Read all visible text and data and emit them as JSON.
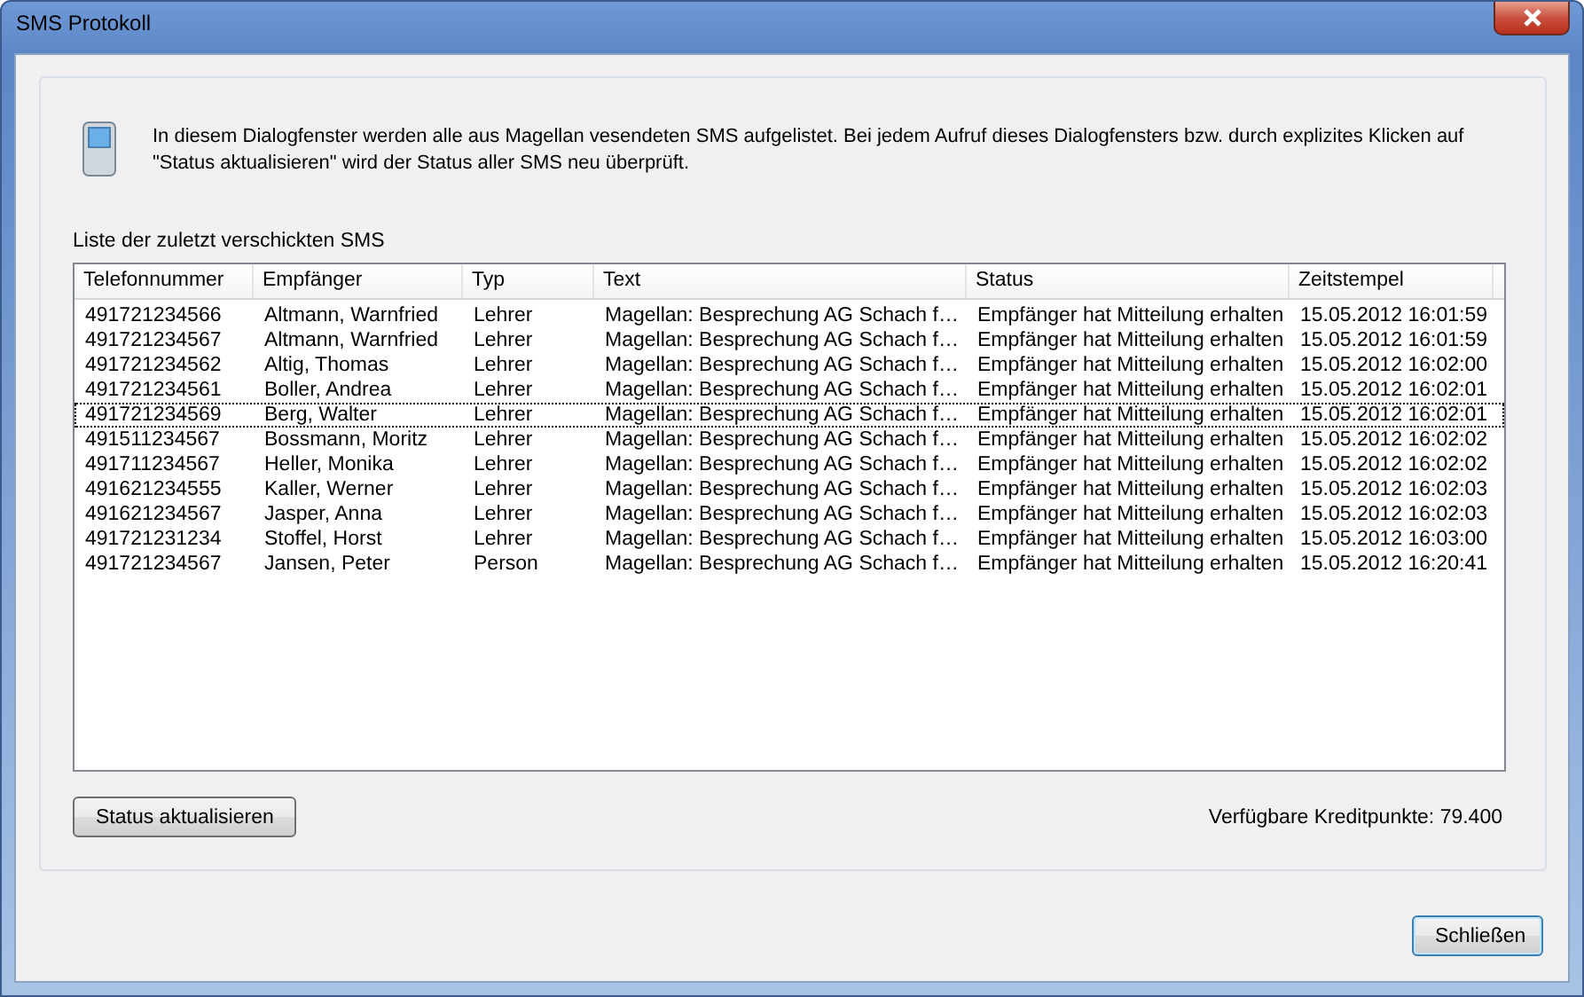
{
  "window": {
    "title": "SMS Protokoll"
  },
  "info_text": "In diesem Dialogfenster werden alle aus Magellan vesendeten SMS aufgelistet. Bei jedem Aufruf dieses Dialogfensters bzw. durch explizites Klicken auf \"Status aktualisieren\" wird der Status aller SMS neu überprüft.",
  "list_label": "Liste der zuletzt verschickten SMS",
  "table": {
    "columns": [
      "Telefonnummer",
      "Empfänger",
      "Typ",
      "Text",
      "Status",
      "Zeitstempel"
    ],
    "rows": [
      {
        "cells": [
          "491721234566",
          "Altmann, Warnfried",
          "Lehrer",
          "Magellan: Besprechung AG Schach f…",
          "Empfänger hat Mitteilung erhalten",
          "15.05.2012 16:01:59"
        ],
        "focused": false
      },
      {
        "cells": [
          "491721234567",
          "Altmann, Warnfried",
          "Lehrer",
          "Magellan: Besprechung AG Schach f…",
          "Empfänger hat Mitteilung erhalten",
          "15.05.2012 16:01:59"
        ],
        "focused": false
      },
      {
        "cells": [
          "491721234562",
          "Altig, Thomas",
          "Lehrer",
          "Magellan: Besprechung AG Schach f…",
          "Empfänger hat Mitteilung erhalten",
          "15.05.2012 16:02:00"
        ],
        "focused": false
      },
      {
        "cells": [
          "491721234561",
          "Boller, Andrea",
          "Lehrer",
          "Magellan: Besprechung AG Schach f…",
          "Empfänger hat Mitteilung erhalten",
          "15.05.2012 16:02:01"
        ],
        "focused": false
      },
      {
        "cells": [
          "491721234569",
          "Berg, Walter",
          "Lehrer",
          "Magellan: Besprechung AG Schach f…",
          "Empfänger hat Mitteilung erhalten",
          "15.05.2012 16:02:01"
        ],
        "focused": true
      },
      {
        "cells": [
          "491511234567",
          "Bossmann, Moritz",
          "Lehrer",
          "Magellan: Besprechung AG Schach f…",
          "Empfänger hat Mitteilung erhalten",
          "15.05.2012 16:02:02"
        ],
        "focused": false
      },
      {
        "cells": [
          "491711234567",
          "Heller, Monika",
          "Lehrer",
          "Magellan: Besprechung AG Schach f…",
          "Empfänger hat Mitteilung erhalten",
          "15.05.2012 16:02:02"
        ],
        "focused": false
      },
      {
        "cells": [
          "491621234555",
          "Kaller, Werner",
          "Lehrer",
          "Magellan: Besprechung AG Schach f…",
          "Empfänger hat Mitteilung erhalten",
          "15.05.2012 16:02:03"
        ],
        "focused": false
      },
      {
        "cells": [
          "491621234567",
          "Jasper, Anna",
          "Lehrer",
          "Magellan: Besprechung AG Schach f…",
          "Empfänger hat Mitteilung erhalten",
          "15.05.2012 16:02:03"
        ],
        "focused": false
      },
      {
        "cells": [
          "491721231234",
          "Stoffel, Horst",
          "Lehrer",
          "Magellan: Besprechung AG Schach f…",
          "Empfänger hat Mitteilung erhalten",
          "15.05.2012 16:03:00"
        ],
        "focused": false
      },
      {
        "cells": [
          "491721234567",
          "Jansen, Peter",
          "Person",
          "Magellan: Besprechung AG Schach f…",
          "Empfänger hat Mitteilung erhalten",
          "15.05.2012 16:20:41"
        ],
        "focused": false
      }
    ]
  },
  "refresh_button": "Status aktualisieren",
  "credits": "Verfügbare Kreditpunkte: 79.400",
  "close_button": "Schließen"
}
